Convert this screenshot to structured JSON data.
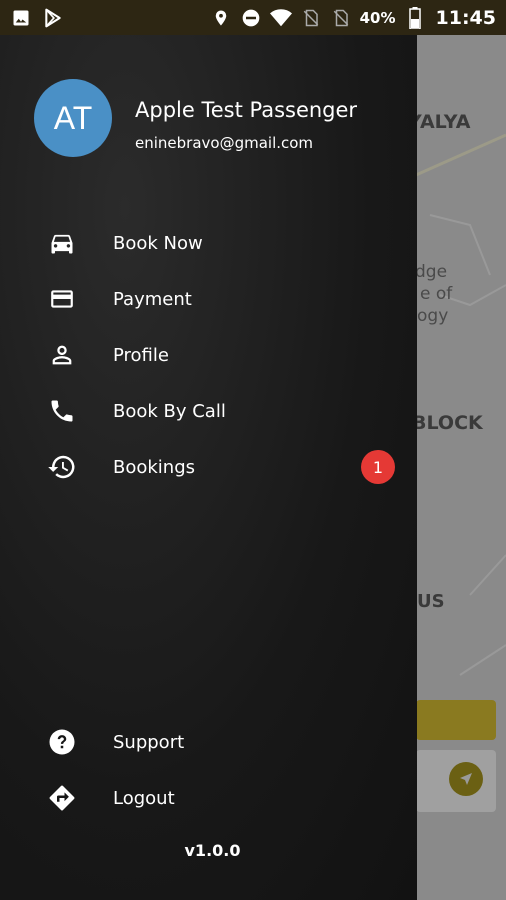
{
  "status_bar": {
    "battery_percent": "40%",
    "time": "11:45",
    "icons": [
      "image-icon",
      "play-store-icon",
      "location-icon",
      "do-not-disturb-icon",
      "wifi-icon",
      "no-sim-icon",
      "no-sim-icon",
      "battery-icon"
    ]
  },
  "map": {
    "labels": [
      "YALYA",
      "dge",
      "e of",
      "ogy",
      "BLOCK",
      "US"
    ]
  },
  "drawer": {
    "avatar_initials": "AT",
    "avatar_color": "#4a90c6",
    "user_name": "Apple Test Passenger",
    "user_email": "eninebravo@gmail.com",
    "menu": [
      {
        "label": "Book Now",
        "icon": "car-icon"
      },
      {
        "label": "Payment",
        "icon": "credit-card-icon"
      },
      {
        "label": "Profile",
        "icon": "person-icon"
      },
      {
        "label": "Book By Call",
        "icon": "phone-icon"
      },
      {
        "label": "Bookings",
        "icon": "history-icon",
        "badge": "1"
      }
    ],
    "footer_menu": [
      {
        "label": "Support",
        "icon": "help-icon"
      },
      {
        "label": "Logout",
        "icon": "directions-icon"
      }
    ],
    "version": "v1.0.0",
    "badge_color": "#e53935"
  }
}
